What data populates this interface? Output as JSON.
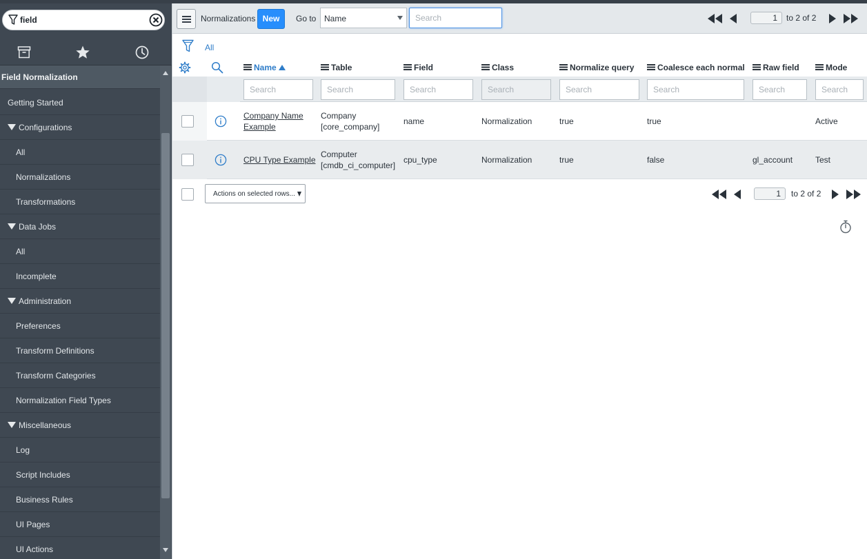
{
  "nav": {
    "filter_value": "field",
    "tabs": [
      "archive-icon",
      "star-icon",
      "history-icon"
    ],
    "items": [
      {
        "label": "Field Normalization",
        "kind": "app"
      },
      {
        "label": "Getting Started",
        "kind": "module"
      },
      {
        "label": "Configurations",
        "kind": "section"
      },
      {
        "label": "All",
        "kind": "child"
      },
      {
        "label": "Normalizations",
        "kind": "child"
      },
      {
        "label": "Transformations",
        "kind": "child"
      },
      {
        "label": "Data Jobs",
        "kind": "section"
      },
      {
        "label": "All",
        "kind": "child"
      },
      {
        "label": "Incomplete",
        "kind": "child"
      },
      {
        "label": "Administration",
        "kind": "section"
      },
      {
        "label": "Preferences",
        "kind": "child"
      },
      {
        "label": "Transform Definitions",
        "kind": "child"
      },
      {
        "label": "Transform Categories",
        "kind": "child"
      },
      {
        "label": "Normalization Field Types",
        "kind": "child"
      },
      {
        "label": "Miscellaneous",
        "kind": "section"
      },
      {
        "label": "Log",
        "kind": "child"
      },
      {
        "label": "Script Includes",
        "kind": "child"
      },
      {
        "label": "Business Rules",
        "kind": "child"
      },
      {
        "label": "UI Pages",
        "kind": "child"
      },
      {
        "label": "UI Actions",
        "kind": "child"
      }
    ]
  },
  "header": {
    "title": "Normalizations",
    "new_label": "New",
    "goto_label": "Go to",
    "goto_field": "Name",
    "search_placeholder": "Search",
    "page_value": "1",
    "page_total": "to 2 of 2"
  },
  "breadcrumb": {
    "label": "All"
  },
  "columns": [
    {
      "label": "Name",
      "sorted": true
    },
    {
      "label": "Table"
    },
    {
      "label": "Field"
    },
    {
      "label": "Class"
    },
    {
      "label": "Normalize query"
    },
    {
      "label": "Coalesce each normal"
    },
    {
      "label": "Raw field"
    },
    {
      "label": "Mode"
    }
  ],
  "column_search_placeholder": "Search",
  "rows": [
    {
      "name_line1": "Company Name",
      "name_line2": "Example",
      "table_line1": "Company",
      "table_line2": "[core_company]",
      "field": "name",
      "class": "Normalization",
      "normalize_query": "true",
      "coalesce": "true",
      "raw_field": "",
      "mode": "Active"
    },
    {
      "name_line1": "CPU Type Example",
      "name_line2": "",
      "table_line1": "Computer",
      "table_line2": "[cmdb_ci_computer]",
      "field": "cpu_type",
      "class": "Normalization",
      "normalize_query": "true",
      "coalesce": "false",
      "raw_field": "gl_account",
      "mode": "Test"
    }
  ],
  "footer": {
    "actions_label": "Actions on selected rows...",
    "page_value": "1",
    "page_total": "to 2 of 2"
  },
  "colors": {
    "nav_bg": "#3f4852",
    "accent": "#278efc",
    "link": "#2f7dc9"
  }
}
